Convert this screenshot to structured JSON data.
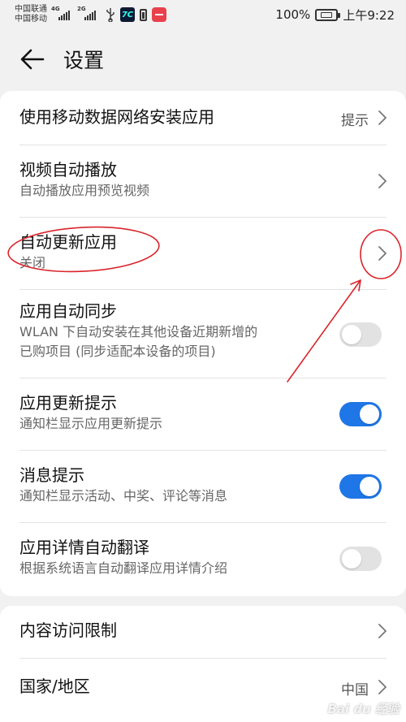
{
  "status_bar": {
    "carrier_1": "中国联通",
    "carrier_2": "中国移动",
    "signal_tag_1": "4G",
    "signal_tag_2": "2G",
    "app_icon_text": "7C",
    "battery": "100%",
    "time": "上午9:22"
  },
  "header": {
    "title": "设置"
  },
  "settings": {
    "mobile_data": {
      "title": "使用移动数据网络安装应用",
      "value": "提示"
    },
    "video_autoplay": {
      "title": "视频自动播放",
      "subtitle": "自动播放应用预览视频"
    },
    "auto_update": {
      "title": "自动更新应用",
      "subtitle": "关闭"
    },
    "auto_sync": {
      "title": "应用自动同步",
      "subtitle_line1": "WLAN 下自动安装在其他设备近期新增的",
      "subtitle_line2": "已购项目 (同步适配本设备的项目)",
      "enabled": false
    },
    "update_notice": {
      "title": "应用更新提示",
      "subtitle": "通知栏显示应用更新提示",
      "enabled": true
    },
    "message_notice": {
      "title": "消息提示",
      "subtitle": "通知栏显示活动、中奖、评论等消息",
      "enabled": true
    },
    "auto_translate": {
      "title": "应用详情自动翻译",
      "subtitle": "根据系统语言自动翻译应用详情介绍",
      "enabled": false
    },
    "content_restrict": {
      "title": "内容访问限制"
    },
    "region": {
      "title": "国家/地区",
      "value": "中国"
    }
  },
  "colors": {
    "accent": "#1f76e6",
    "annotation": "#d9252b"
  },
  "watermark": "Bai du 经验"
}
